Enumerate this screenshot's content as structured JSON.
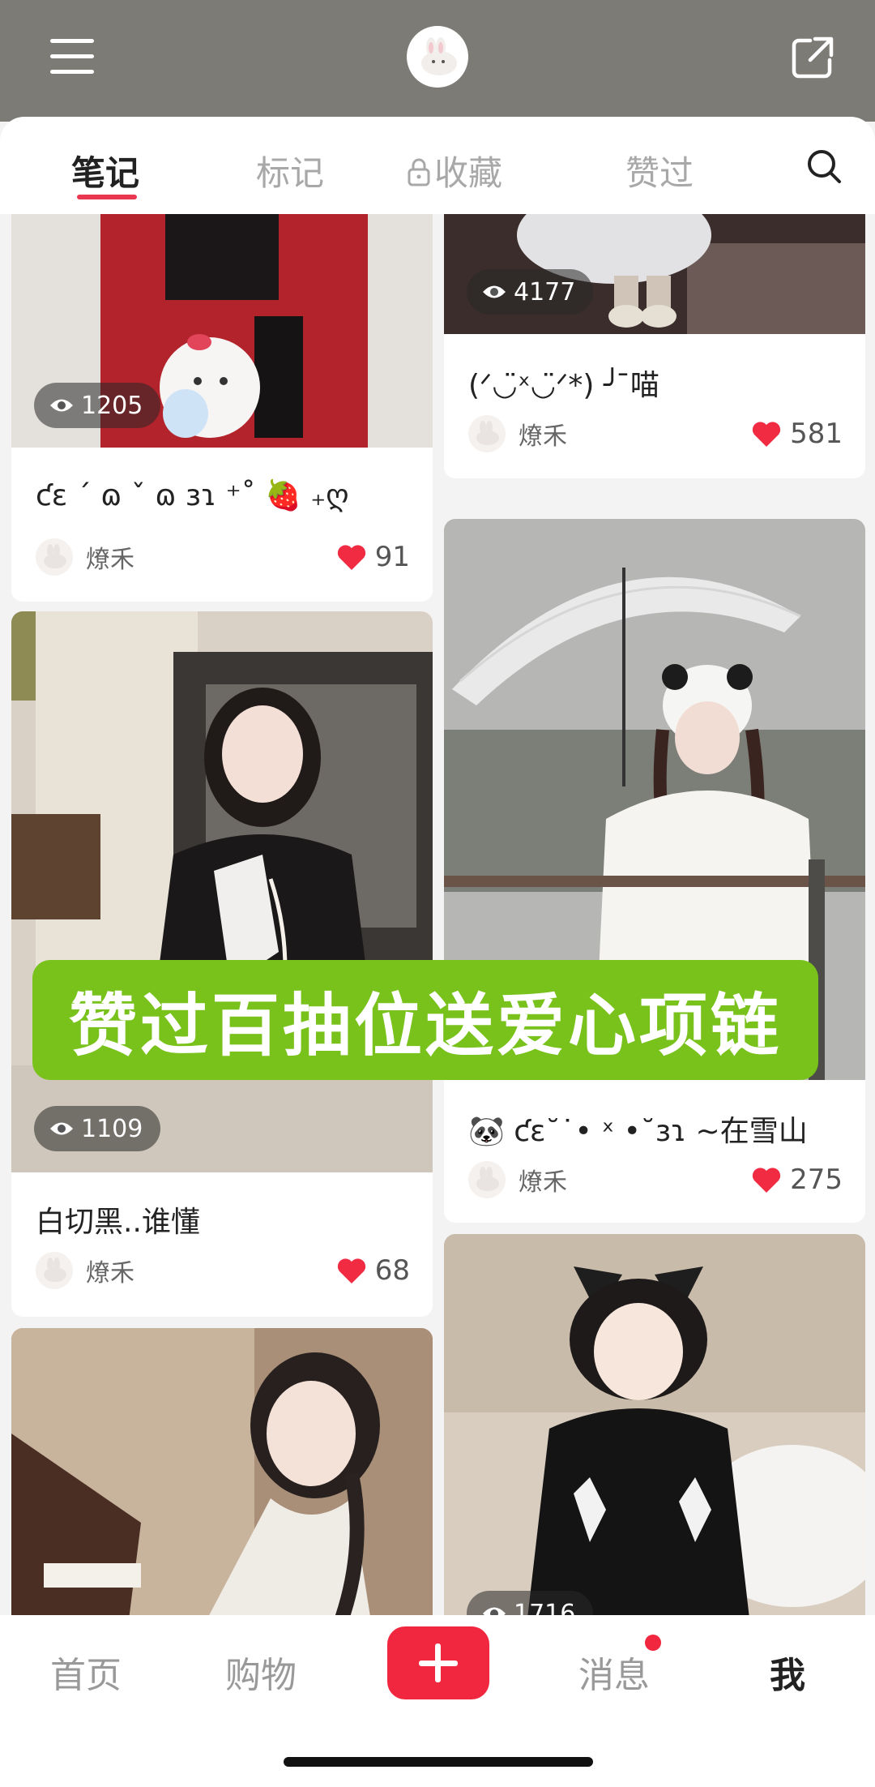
{
  "header": {
    "menu_icon": "hamburger-icon",
    "avatar_icon": "bunny-avatar",
    "share_icon": "share-icon"
  },
  "tabs": [
    {
      "label": "笔记",
      "active": true
    },
    {
      "label": "标记",
      "active": false
    },
    {
      "label": "收藏",
      "active": false,
      "icon": "lock-icon"
    },
    {
      "label": "赞过",
      "active": false
    }
  ],
  "search_icon": "search-icon",
  "cards": [
    {
      "views": "1205",
      "title": "ƈɛ ˊ ɷ ˇ ɷ ɜɿ ⁺˚ 🍓 ₊ღ",
      "author": "燎禾",
      "likes": "91"
    },
    {
      "views": "4177",
      "title": "(ᐟ◡̈ˣ◡̈ᐟ*) ╯ ̄喵",
      "author": "燎禾",
      "likes": "581"
    },
    {
      "views": "1109",
      "title": "白切黑..谁懂",
      "author": "燎禾",
      "likes": "68"
    },
    {
      "views": "",
      "title": "🐼 ƈɛ˘˙• ˣ •˘ɜɿ ~在雪山",
      "author": "燎禾",
      "likes": "275"
    },
    {
      "views": "",
      "title": "",
      "author": "",
      "likes": ""
    },
    {
      "views": "1716",
      "title": "",
      "author": "",
      "likes": ""
    }
  ],
  "promo_banner": "赞过百抽位送爱心项链",
  "bottom_nav": [
    {
      "label": "首页",
      "active": false
    },
    {
      "label": "购物",
      "active": false
    },
    {
      "label": "消息",
      "active": false,
      "badge": true
    },
    {
      "label": "我",
      "active": true
    }
  ],
  "colors": {
    "accent": "#e8374f",
    "header_bg": "#7d7b76",
    "promo_bg": "#78c21b",
    "add_button": "#f0273e"
  }
}
